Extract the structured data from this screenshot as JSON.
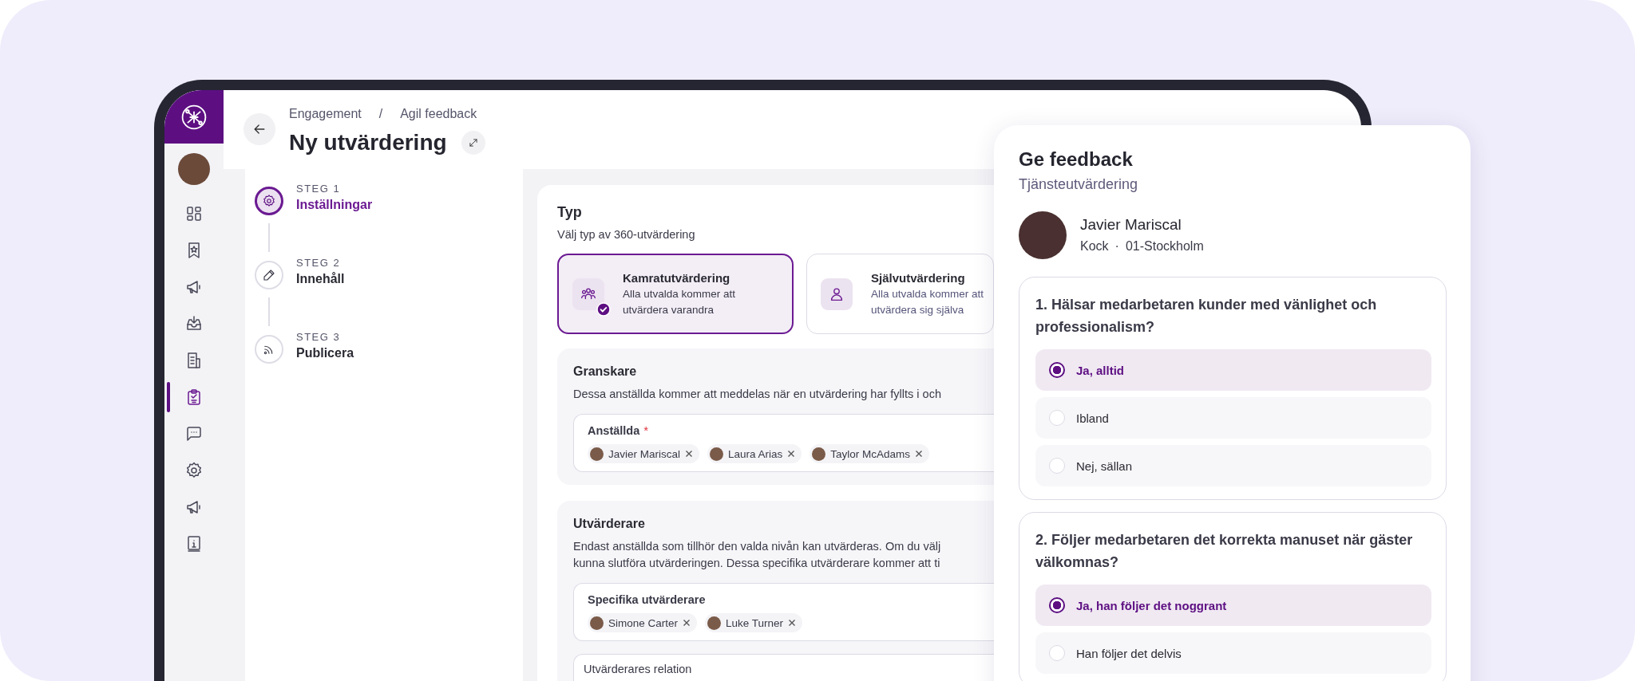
{
  "sidebar": {
    "items": [
      {
        "kind": "grid",
        "selected": false
      },
      {
        "kind": "bookmark",
        "selected": false
      },
      {
        "kind": "megaphone",
        "selected": false
      },
      {
        "kind": "inbox",
        "selected": false
      },
      {
        "kind": "document",
        "selected": false
      },
      {
        "kind": "clipboard",
        "selected": true
      },
      {
        "kind": "chat",
        "selected": false
      },
      {
        "kind": "gear",
        "selected": false
      },
      {
        "kind": "megaphone",
        "selected": false
      },
      {
        "kind": "info",
        "selected": false
      }
    ]
  },
  "breadcrumb": {
    "items": [
      "Engagement",
      "Agil feedback"
    ],
    "separator": "/"
  },
  "title": "Ny utvärdering",
  "steps": [
    {
      "label": "STEG 1",
      "name": "Inställningar",
      "kind": "gear",
      "selected": true
    },
    {
      "label": "STEG 2",
      "name": "Innehåll",
      "kind": "pencil",
      "selected": false
    },
    {
      "label": "STEG 3",
      "name": "Publicera",
      "kind": "broadcast",
      "selected": false
    }
  ],
  "type_section": {
    "title": "Typ",
    "subtitle": "Välj typ av 360-utvärdering",
    "options": [
      {
        "kind": "group",
        "title": "Kamratutvärdering",
        "description": [
          "Alla utvalda kommer att",
          "utvärdera varandra"
        ],
        "selected": true
      },
      {
        "kind": "person",
        "title": "Självutvärdering",
        "description": [
          "Alla utvalda kommer att",
          "utvärdera sig själva"
        ],
        "selected": false
      }
    ]
  },
  "reviewers": {
    "title": "Granskare",
    "lines": [
      "Dessa anställda kommer att meddelas när en utvärdering har fyllts i och"
    ],
    "fields": [
      {
        "label": "Anställda",
        "required_mark": "*",
        "chips": [
          "Javier Mariscal",
          "Laura Arias",
          "Taylor McAdams"
        ]
      }
    ]
  },
  "evaluators": {
    "title": "Utvärderare",
    "lines": [
      "Endast anställda som tillhör den valda nivån kan utvärderas. Om du välj",
      "kunna slutföra utvärderingen. Dessa specifika utvärderare kommer att ti"
    ],
    "fields": [
      {
        "label": "Specifika utvärderare",
        "chips": [
          "Simone Carter",
          "Luke Turner"
        ]
      },
      {
        "label": "Utvärderares relation"
      }
    ]
  },
  "feedback_panel": {
    "title": "Ge feedback",
    "subtitle": "Tjänsteutvärdering",
    "person": {
      "name": "Javier Mariscal",
      "role": "Kock",
      "separator": "·",
      "location": "01-Stockholm"
    },
    "questions": [
      {
        "text": "1. Hälsar medarbetaren kunder med vänlighet och professionalism?",
        "options": [
          {
            "label": "Ja, alltid",
            "selected": true
          },
          {
            "label": "Ibland",
            "selected": false
          },
          {
            "label": "Nej, sällan",
            "selected": false
          }
        ]
      },
      {
        "text": "2. Följer medarbetaren det korrekta manuset när gäster välkomnas?",
        "options": [
          {
            "label": "Ja, han följer det noggrant",
            "selected": true
          },
          {
            "label": "Han följer det delvis",
            "selected": false
          }
        ]
      }
    ]
  }
}
